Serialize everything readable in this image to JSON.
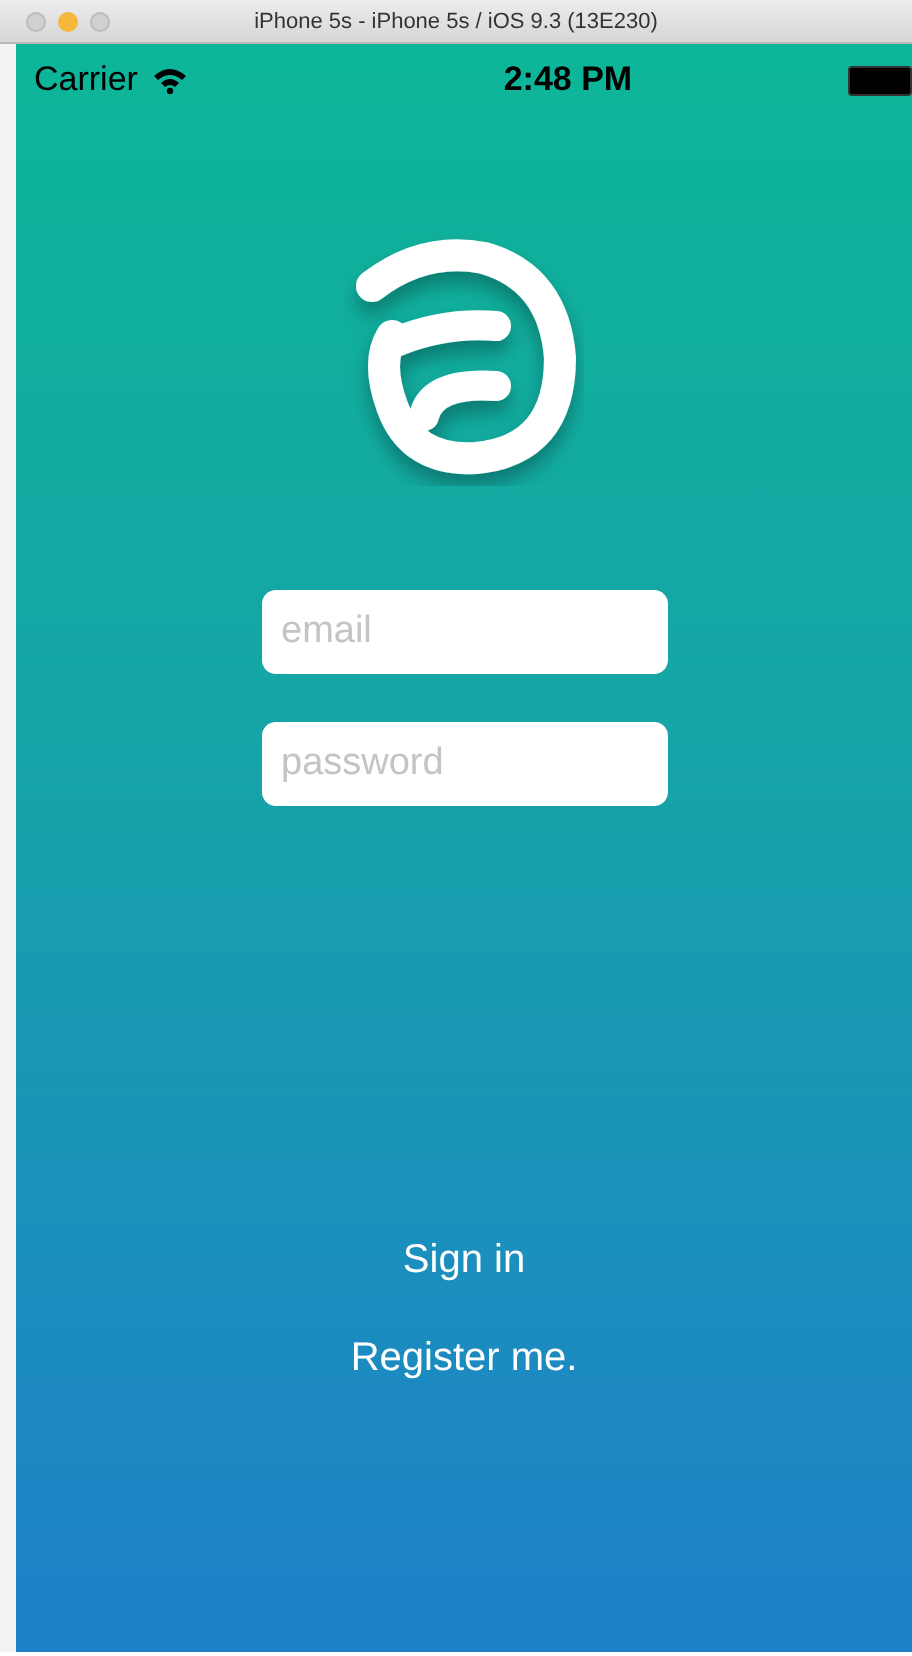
{
  "window": {
    "title": "iPhone 5s - iPhone 5s / iOS 9.3 (13E230)"
  },
  "status_bar": {
    "carrier": "Carrier",
    "time": "2:48 PM"
  },
  "fields": [
    {
      "placeholder": "email"
    },
    {
      "placeholder": "password"
    }
  ],
  "buttons": [
    "Sign in",
    "Register me."
  ]
}
